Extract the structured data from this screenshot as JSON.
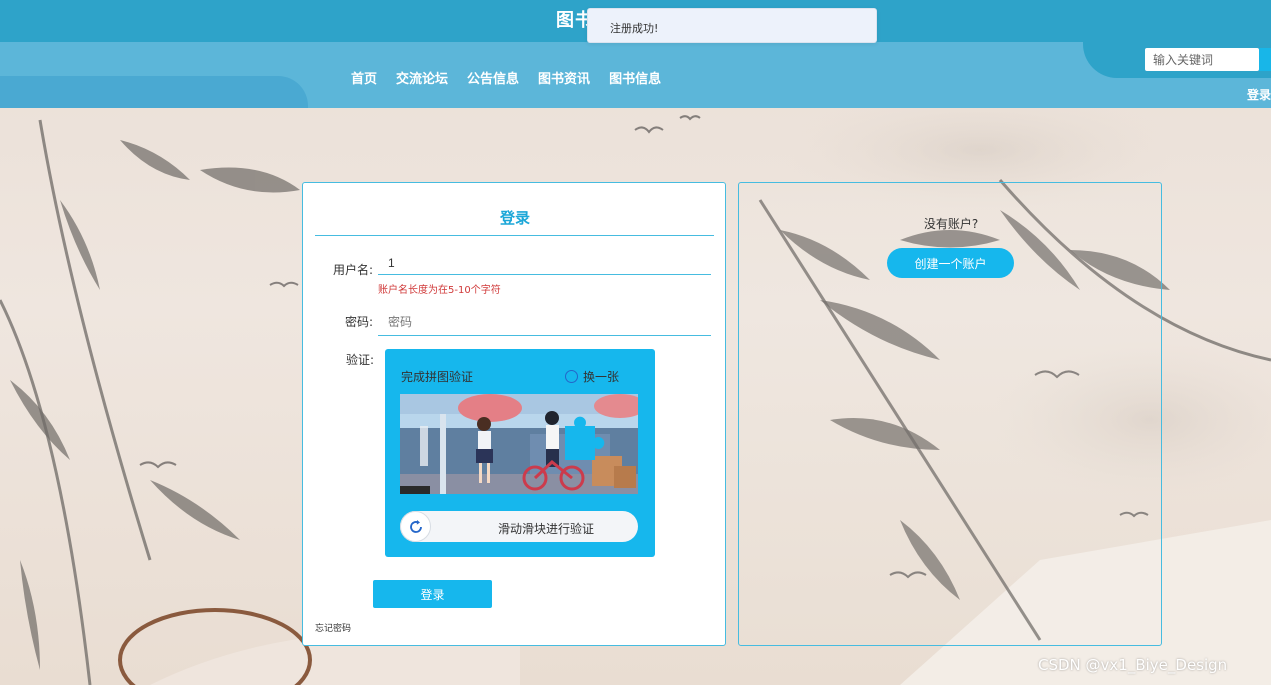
{
  "header": {
    "site_title": "图书",
    "toast": "注册成功!",
    "nav": [
      "首页",
      "交流论坛",
      "公告信息",
      "图书资讯",
      "图书信息"
    ],
    "search_placeholder": "输入关键词",
    "login_link": "登录"
  },
  "login": {
    "title": "登录",
    "username_label": "用户名:",
    "username_value": "1",
    "username_error": "账户名长度为在5-10个字符",
    "password_label": "密码:",
    "password_placeholder": "密码",
    "captcha_label": "验证:",
    "captcha": {
      "title": "完成拼图验证",
      "refresh": "换一张",
      "slider_text": "滑动滑块进行验证"
    },
    "submit": "登录",
    "forgot": "忘记密码"
  },
  "register": {
    "prompt": "没有账户?",
    "create_button": "创建一个账户"
  },
  "watermark": "CSDN @vx1_Biye_Design",
  "colors": {
    "accent": "#16b7ed",
    "header": "#2ea3c9",
    "nav_band": "#5cb6d9",
    "error": "#d03a3a"
  }
}
